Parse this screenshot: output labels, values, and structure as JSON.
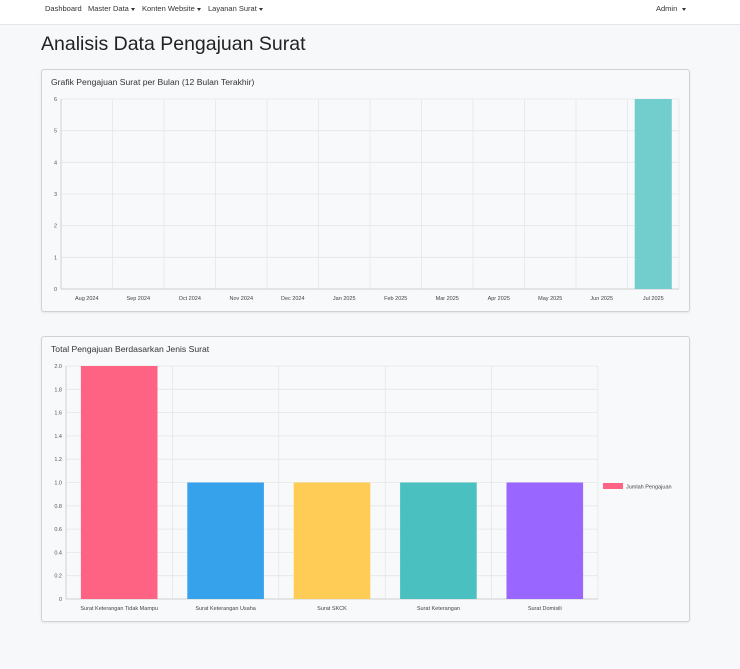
{
  "navbar": {
    "items": [
      {
        "label": "Dashboard",
        "dropdown": false
      },
      {
        "label": "Master Data",
        "dropdown": true
      },
      {
        "label": "Konten Website",
        "dropdown": true
      },
      {
        "label": "Layanan Surat",
        "dropdown": true
      }
    ],
    "user_label": "Admin"
  },
  "page": {
    "title": "Analisis Data Pengajuan Surat"
  },
  "chart_data": [
    {
      "type": "bar",
      "title": "Grafik Pengajuan Surat per Bulan (12 Bulan Terakhir)",
      "categories": [
        "Aug 2024",
        "Sep 2024",
        "Oct 2024",
        "Nov 2024",
        "Dec 2024",
        "Jan 2025",
        "Feb 2025",
        "Mar 2025",
        "Apr 2025",
        "May 2025",
        "Jun 2025",
        "Jul 2025"
      ],
      "values": [
        0,
        0,
        0,
        0,
        0,
        0,
        0,
        0,
        0,
        0,
        0,
        6
      ],
      "ylim": [
        0,
        6
      ],
      "yticks": [
        "0",
        "1",
        "2",
        "3",
        "4",
        "5",
        "6"
      ],
      "bar_colors": [
        "#72cecd"
      ],
      "grid": true
    },
    {
      "type": "bar",
      "title": "Total Pengajuan Berdasarkan Jenis Surat",
      "categories": [
        "Surat Keterangan Tidak Mampu",
        "Surat Keterangan Usaha",
        "Surat SKCK",
        "Surat Keterangan",
        "Surat Domisili"
      ],
      "series": [
        {
          "name": "Jumlah Pengajuan",
          "values": [
            2,
            1,
            1,
            1,
            1
          ]
        }
      ],
      "ylim": [
        0,
        2
      ],
      "yticks": [
        "0",
        "0.2",
        "0.4",
        "0.6",
        "0.8",
        "1.0",
        "1.2",
        "1.4",
        "1.6",
        "1.8",
        "2.0"
      ],
      "bar_colors": [
        "#ff6384",
        "#36a2eb",
        "#ffcd56",
        "#4bc0c0",
        "#9966ff"
      ],
      "legend_color": "#ff6384",
      "legend_position": "right",
      "grid": true
    }
  ]
}
